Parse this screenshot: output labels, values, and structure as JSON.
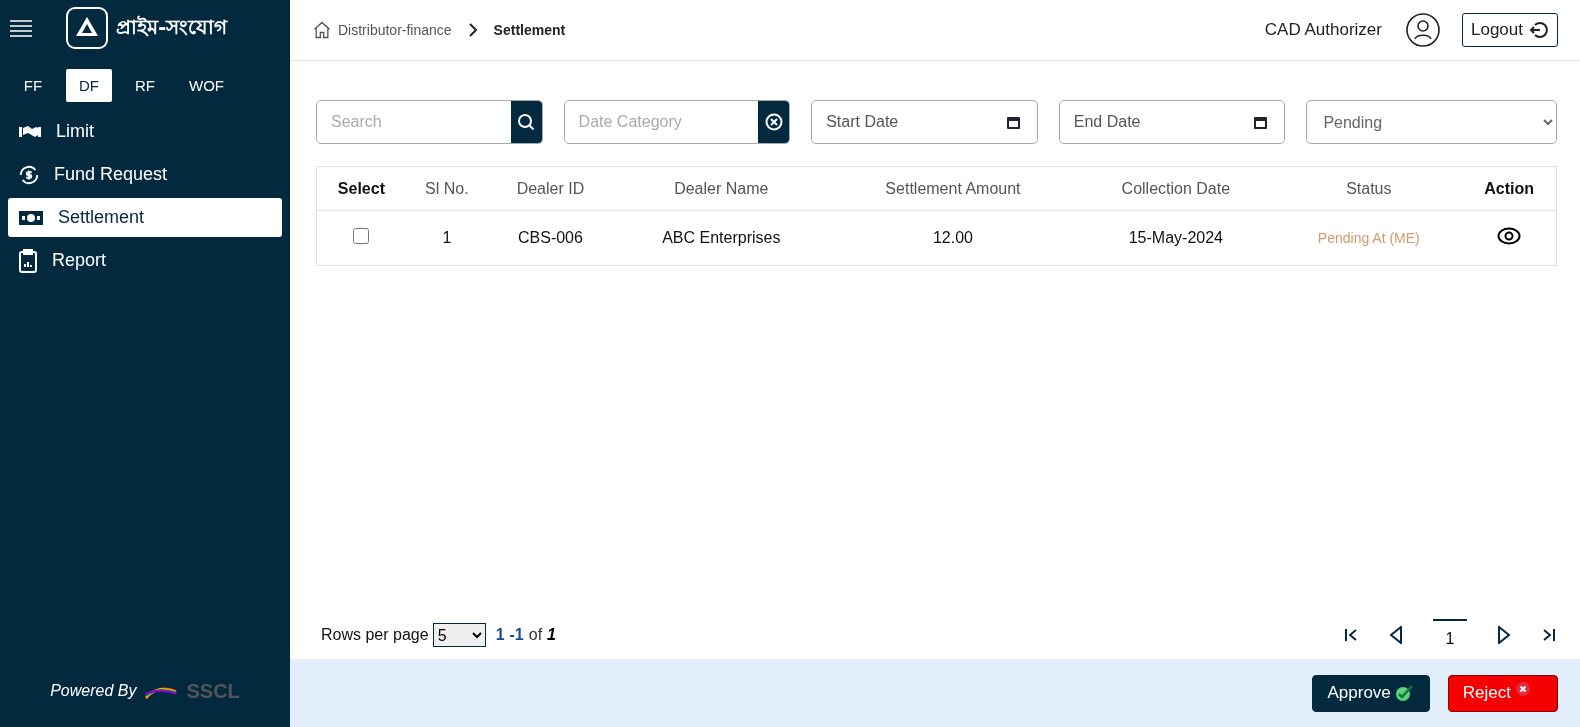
{
  "sidebar": {
    "brand": "প্রাইম-সংযোগ",
    "tabs": [
      {
        "label": "FF",
        "selected": false
      },
      {
        "label": "DF",
        "selected": true
      },
      {
        "label": "RF",
        "selected": false
      },
      {
        "label": "WOF",
        "selected": false
      }
    ],
    "items": [
      {
        "label": "Limit",
        "kind": "handshake",
        "selected": false
      },
      {
        "label": "Fund Request",
        "kind": "dollar",
        "selected": false
      },
      {
        "label": "Settlement",
        "kind": "money",
        "selected": true
      },
      {
        "label": "Report",
        "kind": "clipboard",
        "selected": false
      }
    ],
    "powered_by": "Powered By",
    "vendor": "SSCL"
  },
  "header": {
    "breadcrumb": [
      "Distributor-finance",
      "Settlement"
    ],
    "user": "CAD Authorizer",
    "logout": "Logout"
  },
  "filters": {
    "search": {
      "placeholder": "Search"
    },
    "date_category": {
      "placeholder": "Date Category"
    },
    "start_date": {
      "placeholder": "Start Date"
    },
    "end_date": {
      "placeholder": "End Date"
    },
    "status": {
      "value": "Pending"
    }
  },
  "table": {
    "columns": [
      {
        "label": "Select",
        "bold": true
      },
      {
        "label": "Sl No.",
        "bold": false
      },
      {
        "label": "Dealer ID",
        "bold": false
      },
      {
        "label": "Dealer Name",
        "bold": false
      },
      {
        "label": "Settlement Amount",
        "bold": false
      },
      {
        "label": "Collection Date",
        "bold": false
      },
      {
        "label": "Status",
        "bold": false
      },
      {
        "label": "Action",
        "bold": true
      }
    ],
    "rows": [
      {
        "checked": false,
        "sl": "1",
        "dealer_id": "CBS-006",
        "dealer_name": "ABC Enterprises",
        "amount": "12.00",
        "date": "15-May-2024",
        "status": "Pending At (ME)"
      }
    ]
  },
  "pagination": {
    "rows_label": "Rows per page",
    "rows_value": "5",
    "from": "1",
    "to": "-1",
    "of": "of",
    "total": "1",
    "page": "1"
  },
  "actions": {
    "approve": "Approve",
    "reject": "Reject"
  }
}
